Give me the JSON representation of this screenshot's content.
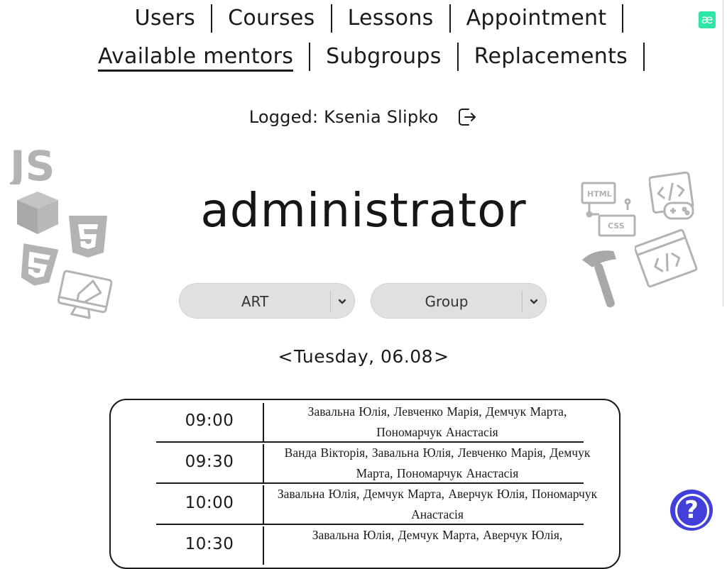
{
  "nav": {
    "row1": [
      {
        "label": "Users",
        "active": false
      },
      {
        "label": "Courses",
        "active": false
      },
      {
        "label": "Lessons",
        "active": false
      },
      {
        "label": "Appointment",
        "active": false
      }
    ],
    "row2": [
      {
        "label": "Available mentors",
        "active": true
      },
      {
        "label": "Subgroups",
        "active": false
      },
      {
        "label": "Replacements",
        "active": false
      }
    ]
  },
  "logo_text": "æ",
  "user": {
    "logged_label": "Logged: Ksenia Slipko",
    "role": "administrator"
  },
  "filters": {
    "course": "ART",
    "group": "Group"
  },
  "date": {
    "prev": "<",
    "label": "Tuesday, 06.08",
    "next": ">"
  },
  "schedule": [
    {
      "time": "09:00",
      "mentors": "Завальна Юлія,  Левченко Марія,  Демчук Марта,  Пономарчук Анастасія"
    },
    {
      "time": "09:30",
      "mentors": "Ванда Вікторія,  Завальна Юлія,  Левченко Марія,  Демчук Марта,  Пономарчук Анастасія"
    },
    {
      "time": "10:00",
      "mentors": "Завальна Юлія,  Демчук Марта,  Аверчук Юлія,  Пономарчук Анастасія"
    },
    {
      "time": "10:30",
      "mentors": "Завальна Юлія,  Демчук Марта,  Аверчук Юлія,"
    }
  ],
  "help_label": "?",
  "colors": {
    "accent": "#4340d9",
    "logo": "#2ee6a8",
    "select_bg": "#e0e0e0",
    "decor": "#b3b3b3"
  },
  "icons": [
    "js-icon",
    "cube-icon",
    "html5-icon",
    "css3-icon",
    "monitor-design-icon",
    "html-css-icon",
    "code-gamepad-icon",
    "hammer-icon",
    "code-window-icon",
    "logout-icon",
    "chevron-down-icon",
    "help-icon"
  ]
}
